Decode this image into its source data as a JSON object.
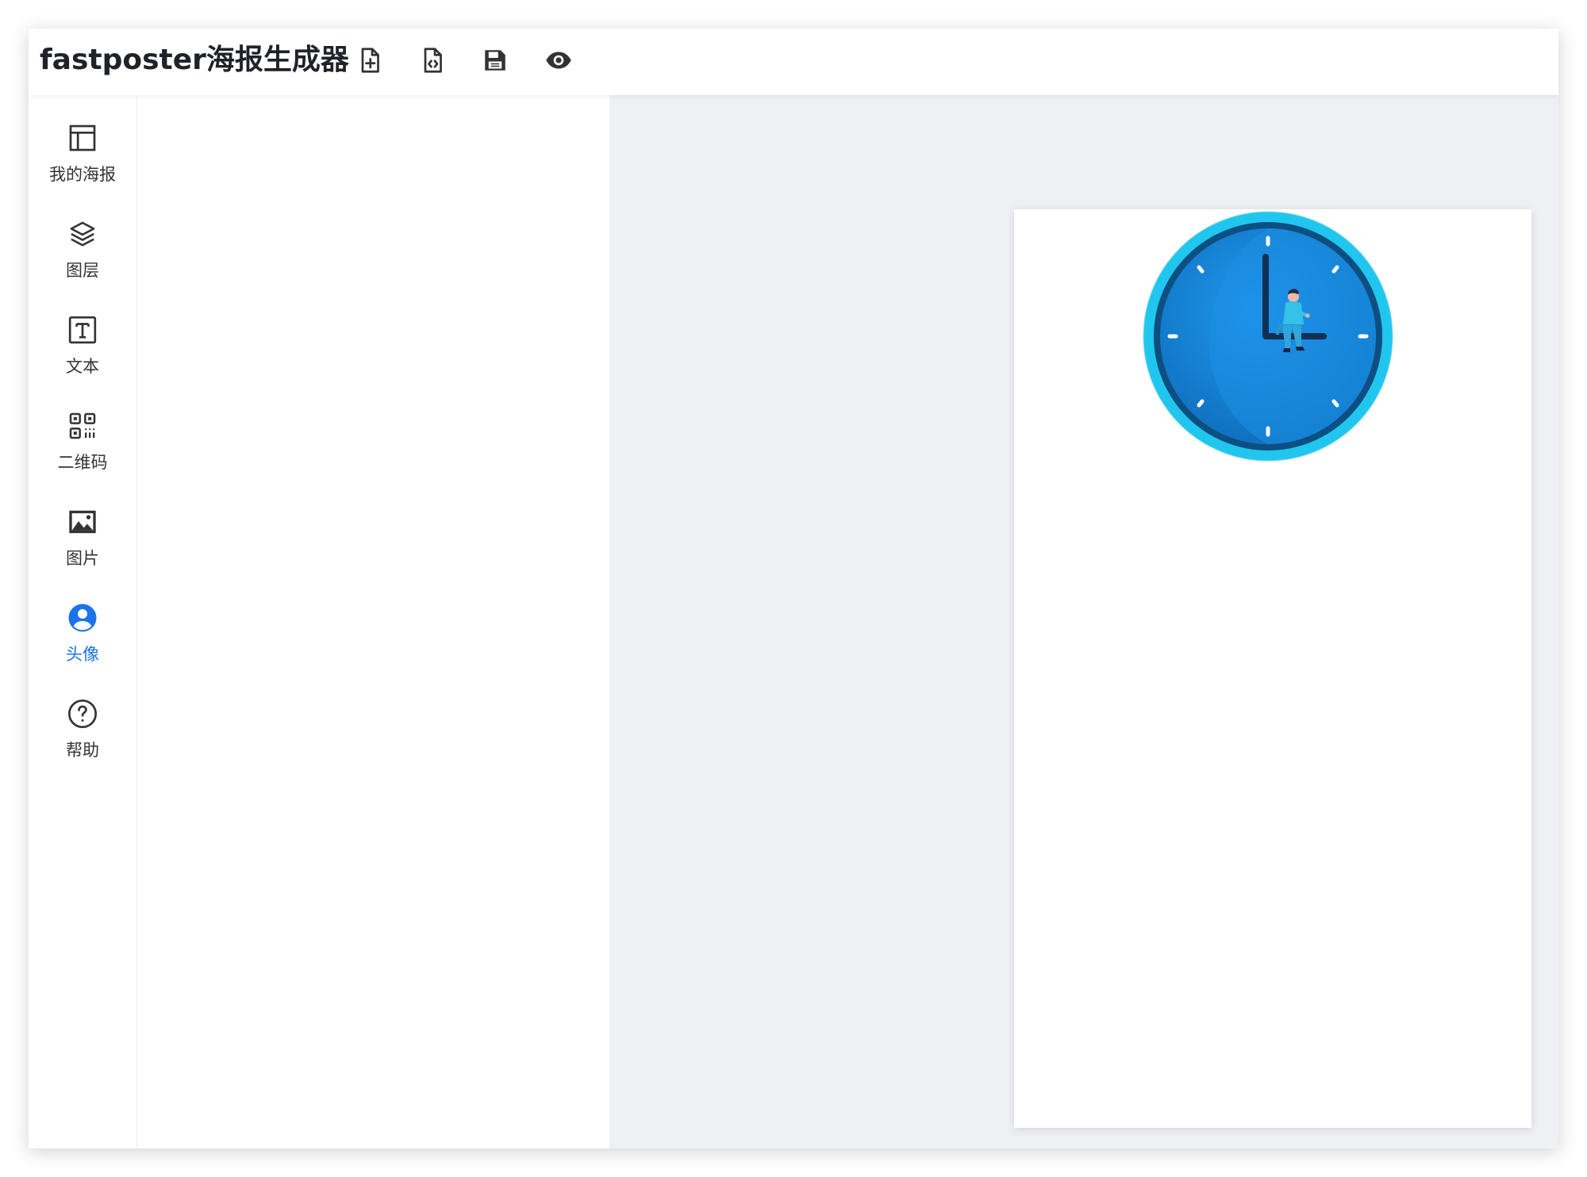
{
  "header": {
    "title": "fastposter海报生成器",
    "tools": [
      {
        "name": "new-poster",
        "icon": "file-plus-icon"
      },
      {
        "name": "view-code",
        "icon": "file-code-icon"
      },
      {
        "name": "save",
        "icon": "save-icon"
      },
      {
        "name": "preview",
        "icon": "eye-icon"
      }
    ]
  },
  "sidebar": {
    "items": [
      {
        "label": "我的海报",
        "icon": "layout-icon",
        "active": false
      },
      {
        "label": "图层",
        "icon": "layers-icon",
        "active": false
      },
      {
        "label": "文本",
        "icon": "text-icon",
        "active": false
      },
      {
        "label": "二维码",
        "icon": "qrcode-icon",
        "active": false
      },
      {
        "label": "图片",
        "icon": "image-icon",
        "active": false
      },
      {
        "label": "头像",
        "icon": "avatar-icon",
        "active": true
      },
      {
        "label": "帮助",
        "icon": "help-icon",
        "active": false
      }
    ]
  },
  "colors": {
    "accent": "#1a73e8",
    "canvas_bg": "#eff0f4",
    "text": "#333333",
    "clock_ring": "#1ec8f0",
    "clock_face": "#1583d6"
  },
  "poster": {
    "elements": [
      {
        "type": "avatar-image",
        "icon": "clock-avatar-icon"
      }
    ]
  }
}
